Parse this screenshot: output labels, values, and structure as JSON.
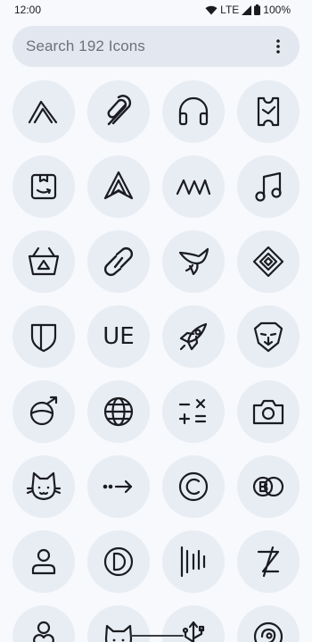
{
  "status_bar": {
    "time": "12:00",
    "network": "LTE",
    "battery": "100%"
  },
  "search": {
    "placeholder": "Search 192 Icons",
    "menu_icon": "more-vert-icon"
  },
  "icons": [
    {
      "name": "triangle-lines-icon"
    },
    {
      "name": "paperclip-swirl-icon"
    },
    {
      "name": "headphones-icon"
    },
    {
      "name": "ticket-icon"
    },
    {
      "name": "amazon-box-icon"
    },
    {
      "name": "navigation-arrow-icon"
    },
    {
      "name": "wave-m-icon"
    },
    {
      "name": "music-note-icon"
    },
    {
      "name": "basket-icon"
    },
    {
      "name": "link-loop-icon"
    },
    {
      "name": "swift-bird-icon"
    },
    {
      "name": "binance-diamond-icon"
    },
    {
      "name": "shield-icon"
    },
    {
      "name": "ue-text-icon",
      "text": "UE"
    },
    {
      "name": "rocket-icon"
    },
    {
      "name": "lion-brave-icon"
    },
    {
      "name": "planet-arrow-icon"
    },
    {
      "name": "globe-icon"
    },
    {
      "name": "calculator-icon"
    },
    {
      "name": "camera-icon"
    },
    {
      "name": "cat-face-icon"
    },
    {
      "name": "dotted-arrow-icon"
    },
    {
      "name": "copyright-icon"
    },
    {
      "name": "double-circle-b-icon"
    },
    {
      "name": "person-icon"
    },
    {
      "name": "half-circle-d-icon"
    },
    {
      "name": "vertical-bars-icon"
    },
    {
      "name": "z-slash-icon"
    },
    {
      "name": "person-heart-icon"
    },
    {
      "name": "cat-head-icon"
    },
    {
      "name": "usb-icon"
    },
    {
      "name": "round-logo-icon"
    }
  ],
  "colors": {
    "background": "#f7f9fd",
    "icon_bg": "#e8edf4",
    "search_bg": "#e3e8f0",
    "foreground": "#1b1c20"
  }
}
